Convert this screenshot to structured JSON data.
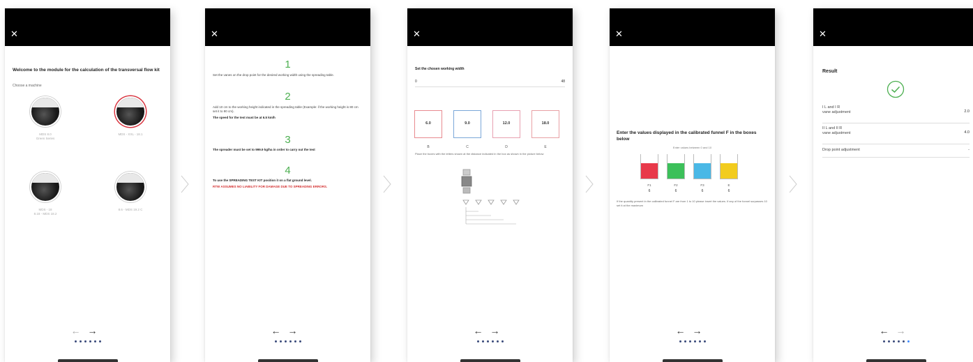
{
  "common": {
    "close_glyph": "✕",
    "prev_arrow": "←",
    "next_arrow": "→"
  },
  "screen1": {
    "title": "Welcome to the module for the calculation of the transversal flow kit",
    "subtitle": "Choose a machine",
    "machines": [
      {
        "caption": "MDS 8.0\nGreen Series",
        "selected": false
      },
      {
        "caption": "MDS - XXL - 18.1",
        "selected": true
      },
      {
        "caption": "MDS - 18\n8.18 - MDS 18.2",
        "selected": false
      },
      {
        "caption": "8.6 - MDS 19.2 C",
        "selected": false
      }
    ]
  },
  "screen2": {
    "steps": [
      {
        "num": "1",
        "text": "Set the vanes on the drop point for the desired working width using the spreading table."
      },
      {
        "num": "2",
        "text": "Add 10 cm to the working height indicated in the spreading table (Example: if the working height is 80 cm set it to 90 cm).",
        "bold": "The speed for the test must be at 6.5 km/h"
      },
      {
        "num": "3",
        "bold": "The spreader must be set to 999.9 kg/ha in order to carry out the test"
      },
      {
        "num": "4",
        "bold": "To use the SPREADING TEST KIT position it on a flat ground level.",
        "red": "RTW ASSUMES NO LIABILITY FOR DAMAGE DUE TO SPREADING ERRORS."
      }
    ]
  },
  "screen3": {
    "title": "Set the chosen working width",
    "range_min": "0",
    "range_max": "48",
    "boxes": [
      {
        "value": "6.0",
        "label": "B",
        "color": "#e88a8f"
      },
      {
        "value": "9.0",
        "label": "C",
        "color": "#7aa7d8"
      },
      {
        "value": "12.0",
        "label": "D",
        "color": "#e8a0b0"
      },
      {
        "value": "18.0",
        "label": "E",
        "color": "#e8a0a4"
      }
    ],
    "note": "Place the boxes with the letters shown at the distance indicated in the box as shown in the picture below"
  },
  "screen4": {
    "title": "Enter the values displayed in the calibrated funnel F in the boxes below",
    "subtitle": "Enter values between 0 and 10",
    "funnels": [
      {
        "label": "F1",
        "value": "6",
        "color": "#e8394a"
      },
      {
        "label": "F2",
        "value": "6",
        "color": "#3cc05a"
      },
      {
        "label": "F3",
        "value": "6",
        "color": "#4ab8e6"
      },
      {
        "label": "E",
        "value": "6",
        "color": "#f2cc1e"
      }
    ],
    "note": "If the quantity present in the calibrated funnel F are from 1 to 10 please insert the values. If any of the funnel surpasses 10 set it at the maximum"
  },
  "screen5": {
    "title": "Result",
    "success_color": "#4caf50",
    "rows": [
      {
        "label": "I L and I R\nvane adjustment",
        "value": "2.0"
      },
      {
        "label": "II L and II R\nvane adjustment",
        "value": "4.0"
      },
      {
        "label": "Drop point adjustment",
        "value": "-"
      }
    ]
  },
  "pagination": {
    "dots": 6,
    "active_screen5": 6
  }
}
